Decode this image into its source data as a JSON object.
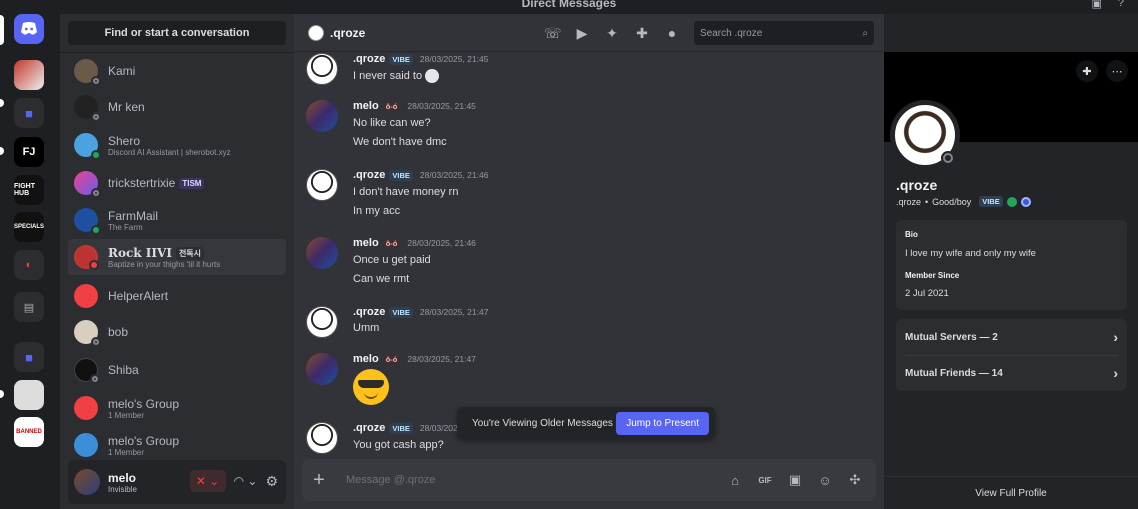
{
  "titlebar": {
    "title": "Direct Messages"
  },
  "dm_sidebar": {
    "find_label": "Find or start a conversation",
    "items": [
      {
        "name": "Kami",
        "sub": "",
        "tag": ""
      },
      {
        "name": "Mr ken",
        "sub": "",
        "tag": ""
      },
      {
        "name": "Shero",
        "sub": "Discord AI Assistant | sherobot.xyz",
        "tag": ""
      },
      {
        "name": "trickstertrixie",
        "sub": "",
        "tag": "TISM"
      },
      {
        "name": "FarmMail",
        "sub": "The Farm",
        "tag": ""
      },
      {
        "name": "Rock IIVI",
        "sub": "Baptize in your thighs 'til it hurts",
        "tag": "전독시"
      },
      {
        "name": "HelperAlert",
        "sub": "",
        "tag": ""
      },
      {
        "name": "bob",
        "sub": "",
        "tag": ""
      },
      {
        "name": "Shiba",
        "sub": "",
        "tag": ""
      },
      {
        "name": "melo's Group",
        "sub": "1 Member",
        "tag": ""
      },
      {
        "name": "melo's Group",
        "sub": "1 Member",
        "tag": ""
      }
    ]
  },
  "user_panel": {
    "name": "melo",
    "status": "Invisible"
  },
  "chat": {
    "recipient": ".qroze",
    "search_placeholder": "Search .qroze",
    "composer_placeholder": "Message @.qroze",
    "older_text": "You're Viewing Older Messages",
    "jump_label": "Jump to Present",
    "messages": [
      {
        "user": ".qroze",
        "badge": "VIBE",
        "time": "28/03/2025, 21:45",
        "lines": [
          "I never said to"
        ]
      },
      {
        "user": "melo",
        "badge": "ô-ó",
        "time": "28/03/2025, 21:45",
        "lines": [
          "No like can we?",
          "We don't have dmc"
        ]
      },
      {
        "user": ".qroze",
        "badge": "VIBE",
        "time": "28/03/2025, 21:46",
        "lines": [
          "I don't have money rn",
          "In my acc"
        ]
      },
      {
        "user": "melo",
        "badge": "ô-ó",
        "time": "28/03/2025, 21:46",
        "lines": [
          "Once u get paid",
          "Can we rmt"
        ]
      },
      {
        "user": ".qroze",
        "badge": "VIBE",
        "time": "28/03/2025, 21:47",
        "lines": [
          "Umm"
        ]
      },
      {
        "user": "melo",
        "badge": "ô-ó",
        "time": "28/03/2025, 21:47",
        "lines": []
      },
      {
        "user": ".qroze",
        "badge": "VIBE",
        "time": "28/03/2025, 21:47",
        "lines": [
          "You got cash app?"
        ]
      }
    ]
  },
  "profile": {
    "display_name": ".qroze",
    "username": ".qroze",
    "pronouns": "Good/boy",
    "badge": "VIBE",
    "bio_label": "Bio",
    "bio": "I love my wife and only my wife",
    "member_since_label": "Member Since",
    "member_since": "2 Jul 2021",
    "mutual_servers": "Mutual Servers — 2",
    "mutual_friends": "Mutual Friends — 14",
    "view_full": "View Full Profile"
  },
  "colors": {
    "accent": "#5865f2",
    "online": "#23a55a",
    "dnd": "#f23f43"
  }
}
